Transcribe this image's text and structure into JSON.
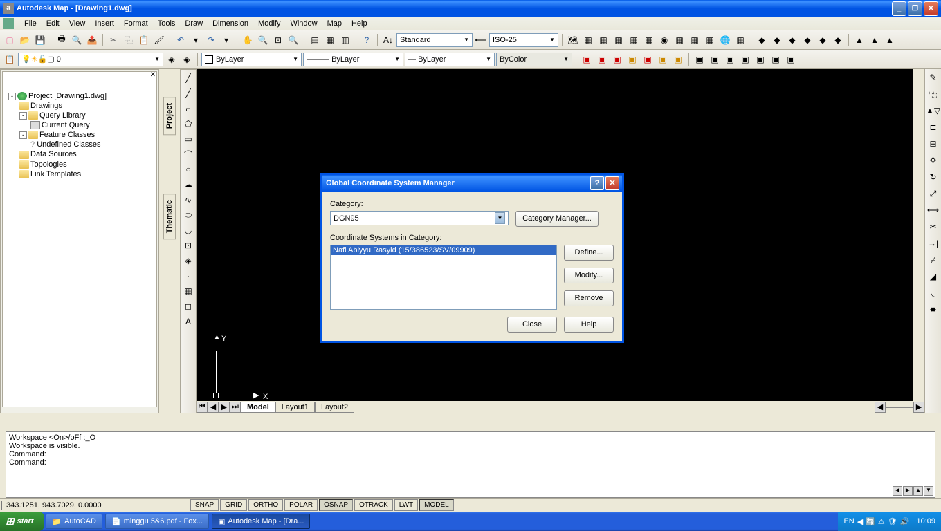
{
  "window": {
    "title": "Autodesk Map - [Drawing1.dwg]"
  },
  "menu": {
    "items": [
      "File",
      "Edit",
      "View",
      "Insert",
      "Format",
      "Tools",
      "Draw",
      "Dimension",
      "Modify",
      "Window",
      "Map",
      "Help"
    ]
  },
  "toolbars": {
    "text_style": "Standard",
    "dim_style": "ISO-25",
    "layer_value": "0",
    "color": "ByLayer",
    "linetype": "ByLayer",
    "lineweight": "ByLayer",
    "plotstyle": "ByColor"
  },
  "sidebar": {
    "tabs": {
      "project_label": "Project",
      "thematic_label": "Thematic"
    },
    "tree": {
      "root": "Project [Drawing1.dwg]",
      "items": [
        {
          "label": "Drawings",
          "indent": 1
        },
        {
          "label": "Query Library",
          "indent": 1,
          "toggle": "-"
        },
        {
          "label": "Current Query",
          "indent": 2
        },
        {
          "label": "Feature Classes",
          "indent": 1,
          "toggle": "-"
        },
        {
          "label": "Undefined Classes",
          "indent": 2
        },
        {
          "label": "Data Sources",
          "indent": 1
        },
        {
          "label": "Topologies",
          "indent": 1
        },
        {
          "label": "Link Templates",
          "indent": 1
        }
      ]
    }
  },
  "canvas": {
    "ucs_x": "X",
    "ucs_y": "Y",
    "tabs": [
      "Model",
      "Layout1",
      "Layout2"
    ]
  },
  "dialog": {
    "title": "Global Coordinate System Manager",
    "category_label": "Category:",
    "category_value": "DGN95",
    "category_mgr": "Category Manager...",
    "list_label": "Coordinate Systems in Category:",
    "list_items": [
      "Nafi Abiyyu Rasyid (15/386523/SV/09909)"
    ],
    "buttons": {
      "define": "Define...",
      "modify": "Modify...",
      "remove": "Remove",
      "close": "Close",
      "help": "Help"
    }
  },
  "command": {
    "lines": [
      "Workspace <On>/oFf :_O",
      "Workspace is visible.",
      "Command:",
      "Command:"
    ]
  },
  "status": {
    "coords": "343.1251, 943.7029, 0.0000",
    "toggles": [
      "SNAP",
      "GRID",
      "ORTHO",
      "POLAR",
      "OSNAP",
      "OTRACK",
      "LWT",
      "MODEL"
    ],
    "active_toggles": [
      "OSNAP",
      "MODEL"
    ]
  },
  "taskbar": {
    "start_label": "start",
    "tasks": [
      {
        "label": "AutoCAD"
      },
      {
        "label": "minggu 5&6.pdf - Fox..."
      },
      {
        "label": "Autodesk Map - [Dra..."
      }
    ],
    "lang": "EN",
    "clock": "10:09"
  }
}
